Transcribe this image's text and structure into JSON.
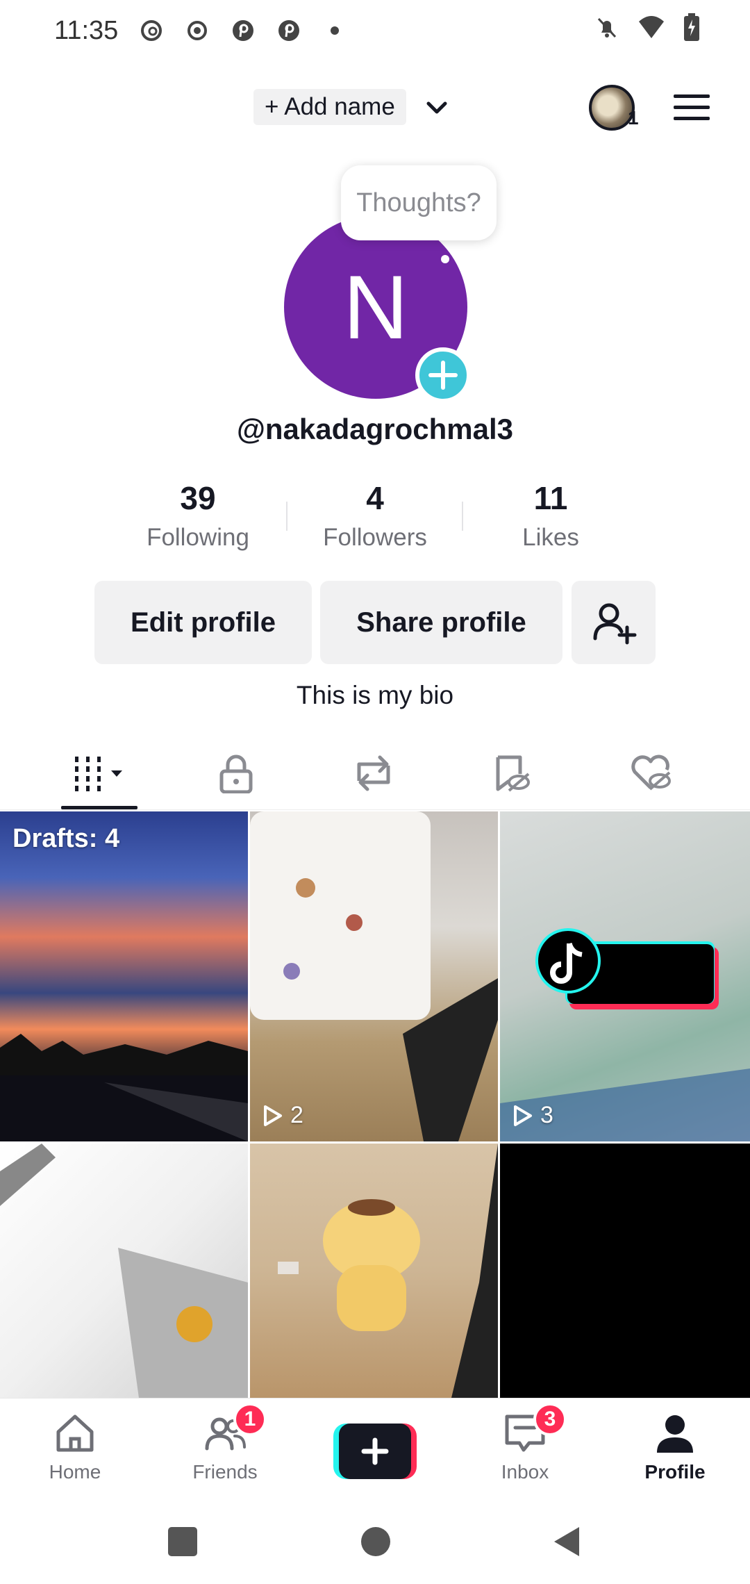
{
  "status_bar": {
    "time": "11:35",
    "left_icons": [
      "threads-icon",
      "record-icon",
      "pinterest-icon",
      "pinterest-icon",
      "dot-icon"
    ],
    "right_icons": [
      "mute-notifications-icon",
      "wifi-icon",
      "battery-charging-icon"
    ]
  },
  "header": {
    "add_name_label": "+ Add name",
    "avatar_badge": "1"
  },
  "profile": {
    "thoughts_prompt": "Thoughts?",
    "avatar_letter": "N",
    "avatar_color": "#7126a6",
    "username": "@nakadagrochmal3",
    "stats": [
      {
        "value": "39",
        "label": "Following"
      },
      {
        "value": "4",
        "label": "Followers"
      },
      {
        "value": "11",
        "label": "Likes"
      }
    ],
    "edit_profile_label": "Edit profile",
    "share_profile_label": "Share profile",
    "bio": "This is my bio"
  },
  "tabs": [
    {
      "name": "videos-grid-icon",
      "active": true
    },
    {
      "name": "lock-icon",
      "active": false
    },
    {
      "name": "repost-icon",
      "active": false
    },
    {
      "name": "favorites-hidden-icon",
      "active": false
    },
    {
      "name": "liked-hidden-icon",
      "active": false
    }
  ],
  "grid": {
    "drafts_label": "Drafts: 4",
    "tiles": [
      {
        "views": ""
      },
      {
        "views": "2"
      },
      {
        "views": "3"
      },
      {
        "views": ""
      },
      {
        "views": ""
      },
      {
        "views": ""
      }
    ]
  },
  "bottom_nav": {
    "home": "Home",
    "friends": "Friends",
    "friends_badge": "1",
    "inbox": "Inbox",
    "inbox_badge": "3",
    "profile": "Profile"
  },
  "colors": {
    "accent_red": "#fe2c55",
    "accent_cyan": "#25f4ee",
    "plus_badge": "#3fc6d8"
  }
}
